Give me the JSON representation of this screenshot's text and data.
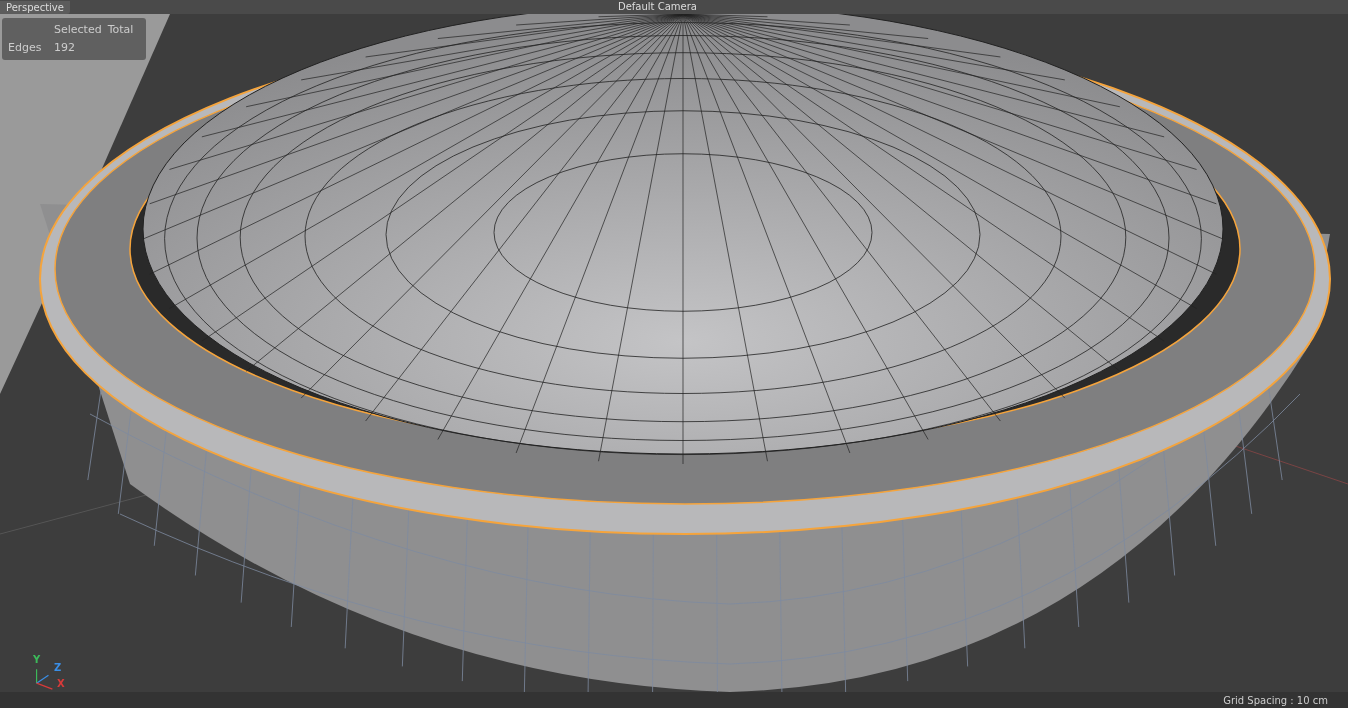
{
  "viewport": {
    "title": "Perspective",
    "camera": "Default Camera"
  },
  "stats": {
    "columns": [
      "Selected",
      "Total"
    ],
    "rows": [
      {
        "label": "Edges",
        "values": [
          "192"
        ]
      }
    ]
  },
  "axes": [
    {
      "label": "Y",
      "color": "#3cb95a"
    },
    {
      "label": "Z",
      "color": "#3a8ee6"
    },
    {
      "label": "X",
      "color": "#d83a3a"
    }
  ],
  "status_bar": {
    "grid_spacing": "Grid Spacing : 10 cm"
  }
}
